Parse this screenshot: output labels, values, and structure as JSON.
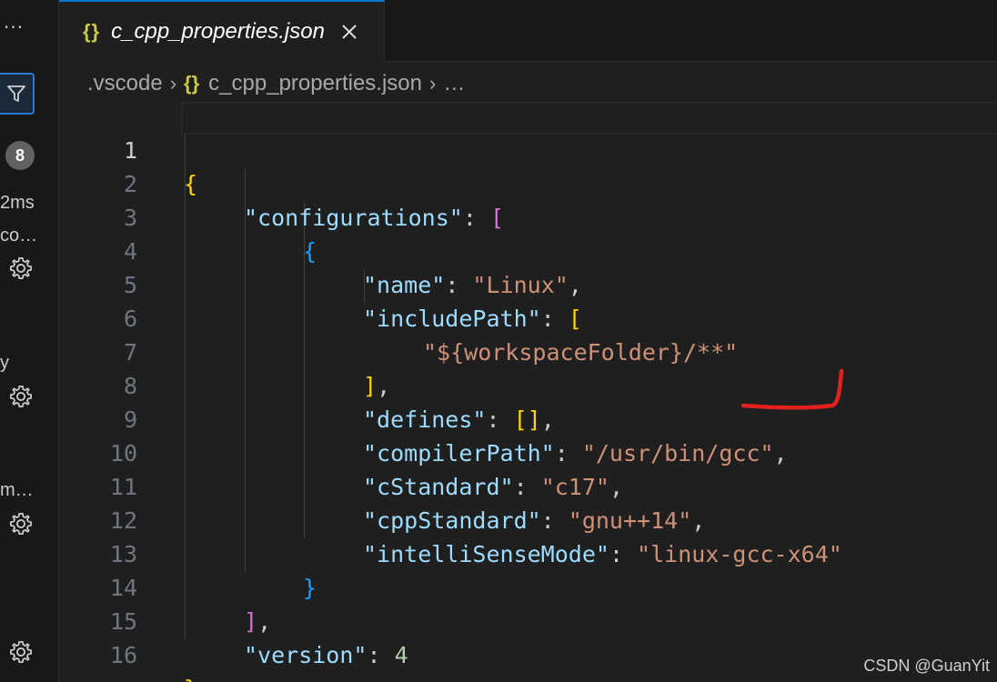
{
  "side_panel": {
    "more_label": "···",
    "badge_count": "8",
    "texts": [
      "2ms",
      "co…",
      "y",
      "m…"
    ]
  },
  "tab": {
    "icon": "{}",
    "title": "c_cpp_properties.json",
    "close_icon": "close-icon"
  },
  "breadcrumb": {
    "folder": ".vscode",
    "file_icon": "{}",
    "file": "c_cpp_properties.json",
    "more": "…"
  },
  "editor": {
    "line_numbers": [
      "1",
      "2",
      "3",
      "4",
      "5",
      "6",
      "7",
      "8",
      "9",
      "10",
      "11",
      "12",
      "13",
      "14",
      "15",
      "16"
    ],
    "current_line": "1",
    "lines": {
      "l1": {
        "brace": "{"
      },
      "l2": {
        "key": "\"configurations\"",
        "colon": ": ",
        "bracket": "["
      },
      "l3": {
        "brace": "{"
      },
      "l4": {
        "key": "\"name\"",
        "colon": ": ",
        "value": "\"Linux\"",
        "comma": ","
      },
      "l5": {
        "key": "\"includePath\"",
        "colon": ": ",
        "bracket": "["
      },
      "l6": {
        "value": "\"${workspaceFolder}/**\""
      },
      "l7": {
        "bracket": "]",
        "comma": ","
      },
      "l8": {
        "key": "\"defines\"",
        "colon": ": ",
        "bracket": "[]",
        "comma": ","
      },
      "l9": {
        "key": "\"compilerPath\"",
        "colon": ": ",
        "value": "\"/usr/bin/gcc\"",
        "comma": ","
      },
      "l10": {
        "key": "\"cStandard\"",
        "colon": ": ",
        "value": "\"c17\"",
        "comma": ","
      },
      "l11": {
        "key": "\"cppStandard\"",
        "colon": ": ",
        "value": "\"gnu++14\"",
        "comma": ","
      },
      "l12": {
        "key": "\"intelliSenseMode\"",
        "colon": ": ",
        "value": "\"linux-gcc-x64\""
      },
      "l13": {
        "brace": "}"
      },
      "l14": {
        "bracket": "]",
        "comma": ","
      },
      "l15": {
        "key": "\"version\"",
        "colon": ": ",
        "value": "4"
      },
      "l16": {
        "brace": "}"
      }
    }
  },
  "watermark": "CSDN @GuanYit",
  "colors": {
    "background": "#1f1f1f",
    "key": "#9cdcfe",
    "string": "#ce9178",
    "number": "#b5cea8",
    "bracket_gold": "#ffd700",
    "bracket_purple": "#da70d6",
    "bracket_blue": "#179fff",
    "annotation_red": "#e0211d"
  }
}
